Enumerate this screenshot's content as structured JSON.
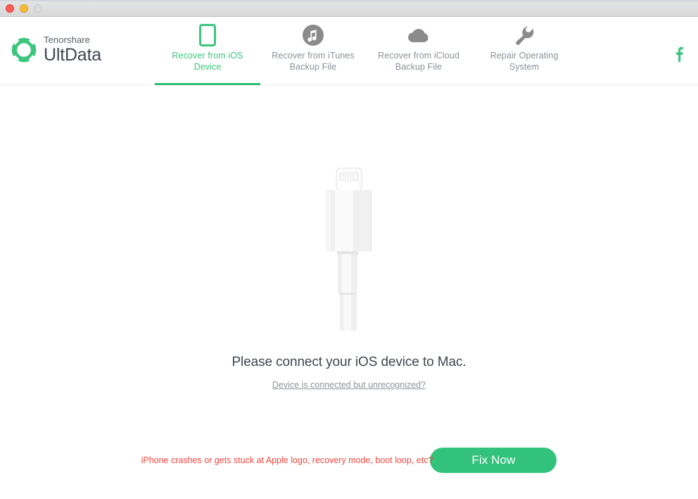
{
  "window": {
    "traffic_lights": [
      "close",
      "minimize",
      "zoom"
    ]
  },
  "brand": {
    "company": "Tenorshare",
    "product": "UltData",
    "logo_icon": "tenorshare-ring-logo",
    "accent_color": "#3cc57f"
  },
  "nav": {
    "tabs": [
      {
        "id": "ios-device",
        "label": "Recover from iOS\nDevice",
        "icon": "iphone-icon",
        "active": true
      },
      {
        "id": "itunes",
        "label": "Recover from iTunes\nBackup File",
        "icon": "itunes-icon",
        "active": false
      },
      {
        "id": "icloud",
        "label": "Recover from iCloud\nBackup File",
        "icon": "icloud-icon",
        "active": false
      },
      {
        "id": "repair-os",
        "label": "Repair Operating\nSystem",
        "icon": "wrench-icon",
        "active": false
      }
    ],
    "social": {
      "icon": "facebook-icon",
      "label": "f",
      "color": "#3cc57f"
    }
  },
  "main": {
    "illustration": "lightning-cable-illustration",
    "headline": "Please connect your iOS device to Mac.",
    "sub_link": "Device is connected but unrecognized?",
    "bottom_note": "iPhone crashes or gets stuck at Apple logo, recovery mode, boot loop, etc?",
    "bottom_note_color": "#f4463f",
    "fix_button": "Fix Now",
    "fix_button_color": "#33c27c"
  }
}
